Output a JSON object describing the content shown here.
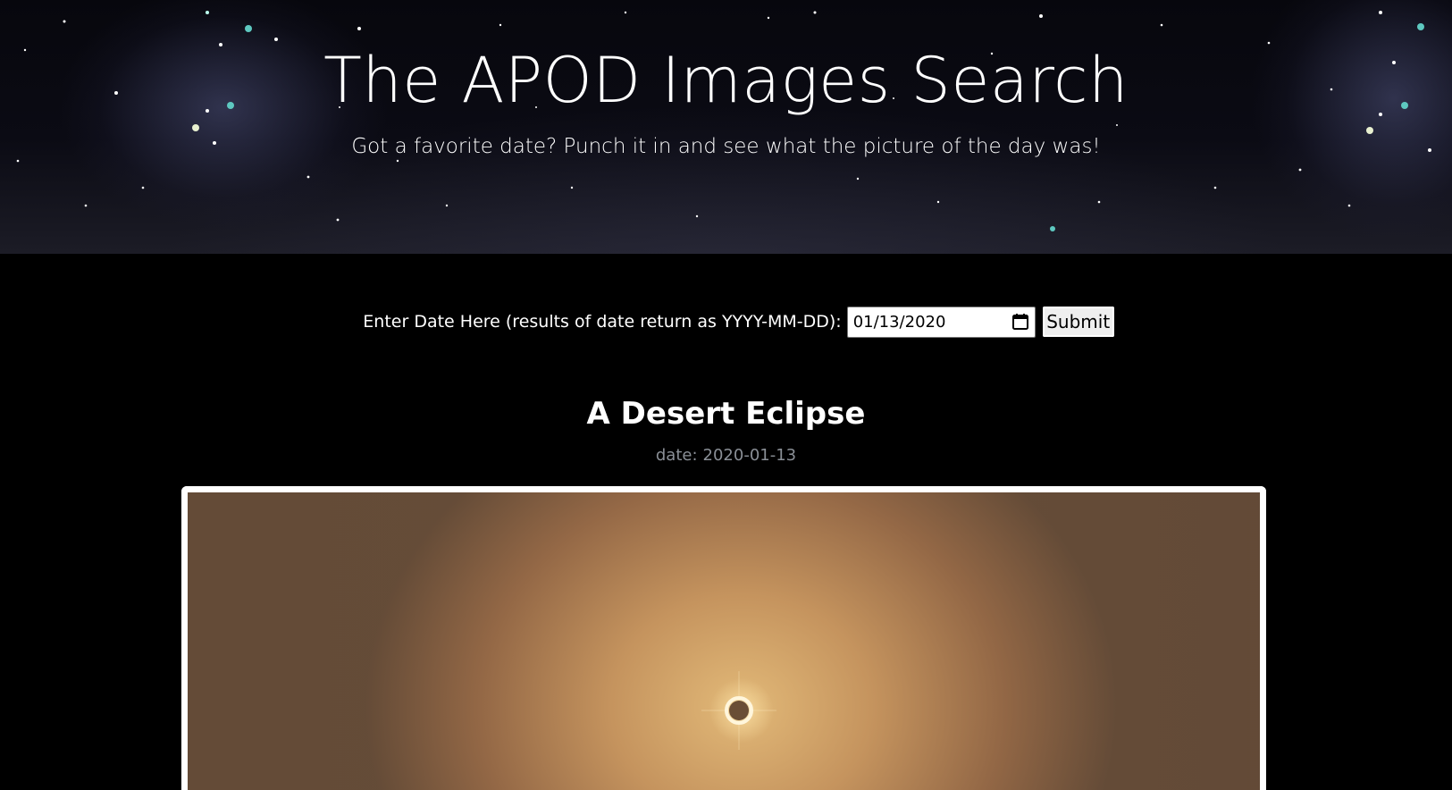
{
  "header": {
    "title": "The APOD Images Search",
    "subtitle": "Got a favorite date? Punch it in and see what the picture of the day was!"
  },
  "search": {
    "label": "Enter Date Here (results of date return as YYYY-MM-DD):",
    "date_value": "01/13/2020",
    "calendar_icon": "calendar-icon",
    "submit_label": "Submit"
  },
  "result": {
    "title": "A Desert Eclipse",
    "date_prefix": "date:",
    "date": "2020-01-13",
    "image_alt": "A Desert Eclipse"
  },
  "colors": {
    "background": "#000000",
    "date_text": "#8a8f96",
    "frame_border": "#ffffff"
  }
}
